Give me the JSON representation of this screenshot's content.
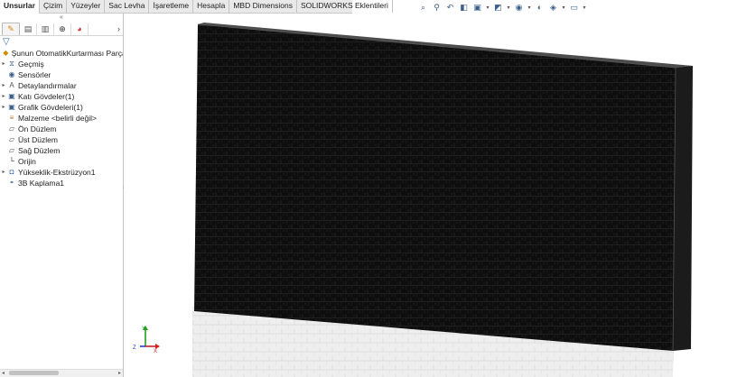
{
  "command_tabs": [
    "Unsurlar",
    "Çizim",
    "Yüzeyler",
    "Sac Levha",
    "İşaretleme",
    "Hesapla",
    "MBD Dimensions",
    "SOLIDWORKS Eklentileri"
  ],
  "active_tab": "Unsurlar",
  "hud_icons": [
    "zoom-fit-icon",
    "zoom-area-icon",
    "previous-view-icon",
    "section-view-icon",
    "view-orientation-icon",
    "display-style-icon",
    "hide-show-icon",
    "edit-appearance-icon",
    "scene-icon",
    "view-settings-icon"
  ],
  "panel": {
    "collapse_glyph": "«",
    "tabs": [
      "feature-manager-icon",
      "property-manager-icon",
      "configuration-manager-icon",
      "dimxpert-icon",
      "display-manager-icon"
    ],
    "more_glyph": "›",
    "filter_icon": "filter-icon",
    "root": "Şunun OtomatikKurtarması Parça1  (V"
  },
  "tree": [
    {
      "label": "Geçmiş",
      "icon": "history-icon",
      "arrow": true
    },
    {
      "label": "Sensörler",
      "icon": "sensors-icon",
      "arrow": false
    },
    {
      "label": "Detaylandırmalar",
      "icon": "annotations-icon",
      "arrow": true
    },
    {
      "label": "Katı Gövdeler(1)",
      "icon": "solid-bodies-icon",
      "arrow": true
    },
    {
      "label": "Grafik Gövdeleri(1)",
      "icon": "graphics-bodies-icon",
      "arrow": true
    },
    {
      "label": "Malzeme <belirli değil>",
      "icon": "material-icon",
      "arrow": false
    },
    {
      "label": "Ön Düzlem",
      "icon": "plane-icon",
      "arrow": false
    },
    {
      "label": "Üst Düzlem",
      "icon": "plane-icon",
      "arrow": false
    },
    {
      "label": "Sağ Düzlem",
      "icon": "plane-icon",
      "arrow": false
    },
    {
      "label": "Orijin",
      "icon": "origin-icon",
      "arrow": false
    },
    {
      "label": "Yükseklik-Ekstrüzyon1",
      "icon": "extrude-icon",
      "arrow": true
    },
    {
      "label": "3B Kaplama1",
      "icon": "3d-texture-icon",
      "arrow": false
    }
  ],
  "triad": {
    "x": "X",
    "y": "Y",
    "z": "Z"
  },
  "colors": {
    "model": "#0f0f0f",
    "model_top": "#4a4a4a",
    "model_side": "#1c1c1c",
    "shadow": "#e8e8e8",
    "axis_x": "#d02020",
    "axis_y": "#20a020",
    "axis_z": "#2040d0"
  }
}
